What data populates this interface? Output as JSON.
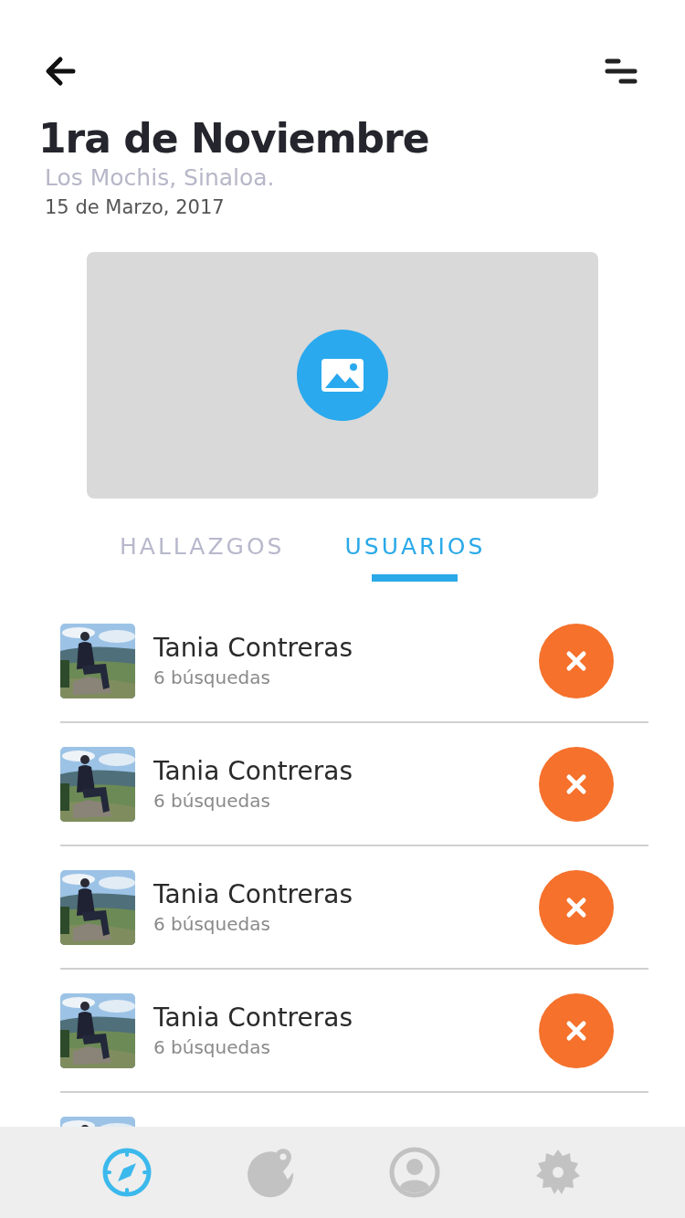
{
  "header": {
    "title": "1ra de Noviembre",
    "location": "Los Mochis, Sinaloa.",
    "date": "15 de Marzo, 2017"
  },
  "media": {
    "kind": "placeholder"
  },
  "tabs": [
    {
      "label": "HALLAZGOS",
      "selected": false
    },
    {
      "label": "USUARIOS",
      "selected": true
    }
  ],
  "users": [
    {
      "name": "Tania Contreras",
      "searches": "6 búsquedas"
    },
    {
      "name": "Tania Contreras",
      "searches": "6 búsquedas"
    },
    {
      "name": "Tania Contreras",
      "searches": "6 búsquedas"
    },
    {
      "name": "Tania Contreras",
      "searches": "6 búsquedas"
    }
  ],
  "nav": [
    {
      "kind": "compass",
      "selected": true
    },
    {
      "kind": "globe",
      "selected": false
    },
    {
      "kind": "profile",
      "selected": false
    },
    {
      "kind": "settings",
      "selected": false
    }
  ]
}
